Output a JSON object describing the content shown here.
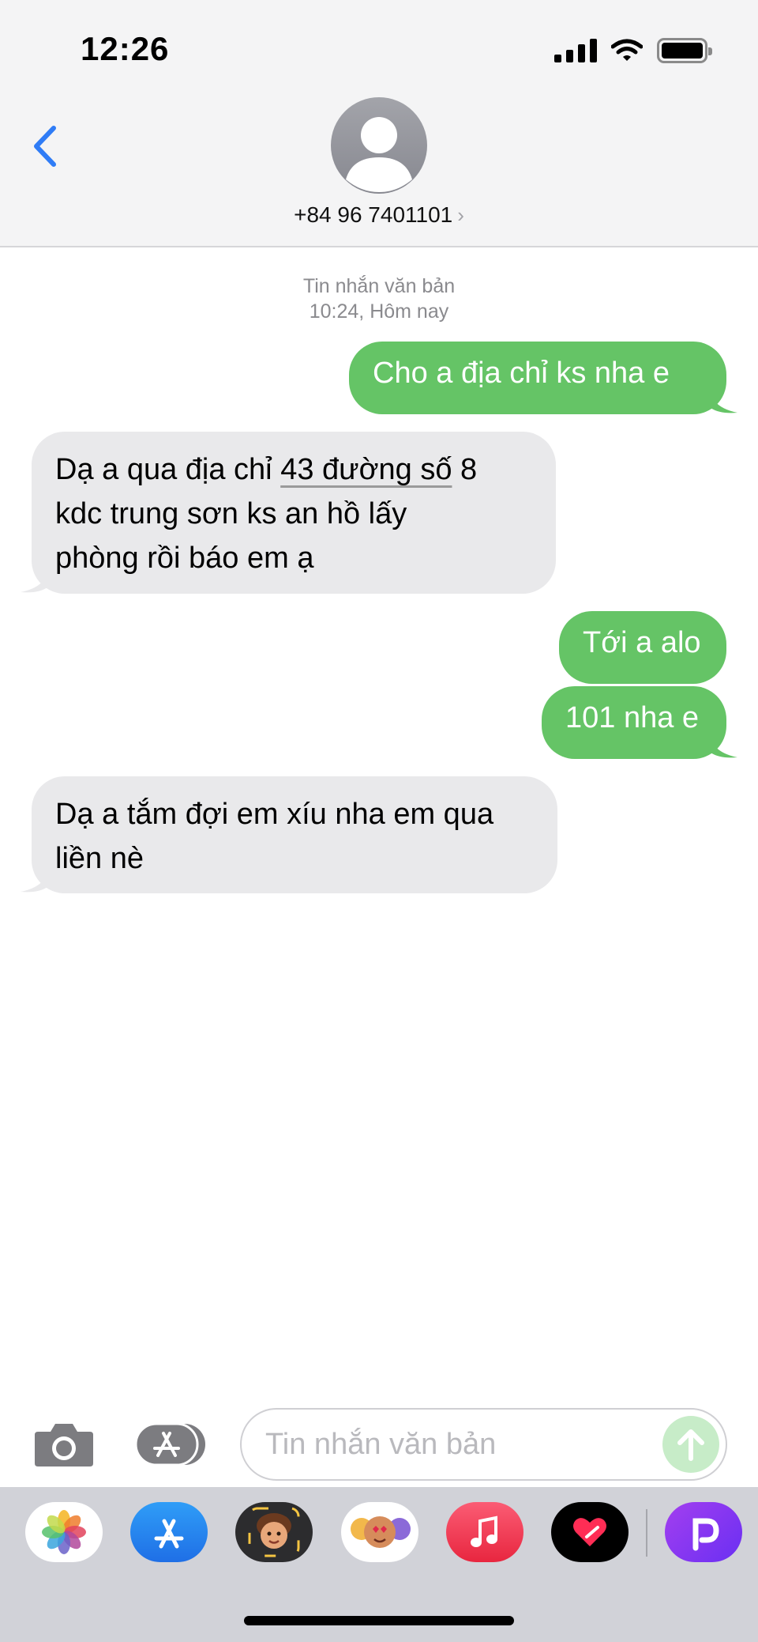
{
  "status_bar": {
    "time": "12:26"
  },
  "header": {
    "contact_number": "+84 96 7401101",
    "chevron": "›"
  },
  "thread": {
    "meta_line1": "Tin nhắn văn bản",
    "meta_line2": "10:24, Hôm nay",
    "messages": [
      {
        "direction": "outgoing",
        "text": "Cho a địa chỉ ks nha e"
      },
      {
        "direction": "incoming",
        "before_link": "Dạ a qua  địa chỉ ",
        "link": "43 đường số",
        "after_link": " 8",
        "line2": "kdc trung sơn  ks an hồ lấy",
        "line3": "phòng rồi báo em ạ"
      },
      {
        "direction": "outgoing",
        "text": "Tới a alo"
      },
      {
        "direction": "outgoing",
        "text": "101 nha e"
      },
      {
        "direction": "incoming",
        "line1": "Dạ a tắm đợi em xíu nha em qua",
        "line2": "liền nè"
      }
    ]
  },
  "composer": {
    "placeholder": "Tin nhắn văn bản"
  },
  "drawer": {
    "apps": [
      "photos-app",
      "app-store-app",
      "memoji-app",
      "animoji-stickers-app",
      "music-app",
      "digital-touch-app",
      "picsart-app"
    ]
  },
  "colors": {
    "outgoing_bubble": "#65c466",
    "incoming_bubble": "#e9e9eb",
    "accent_blue": "#2f7cf6"
  }
}
